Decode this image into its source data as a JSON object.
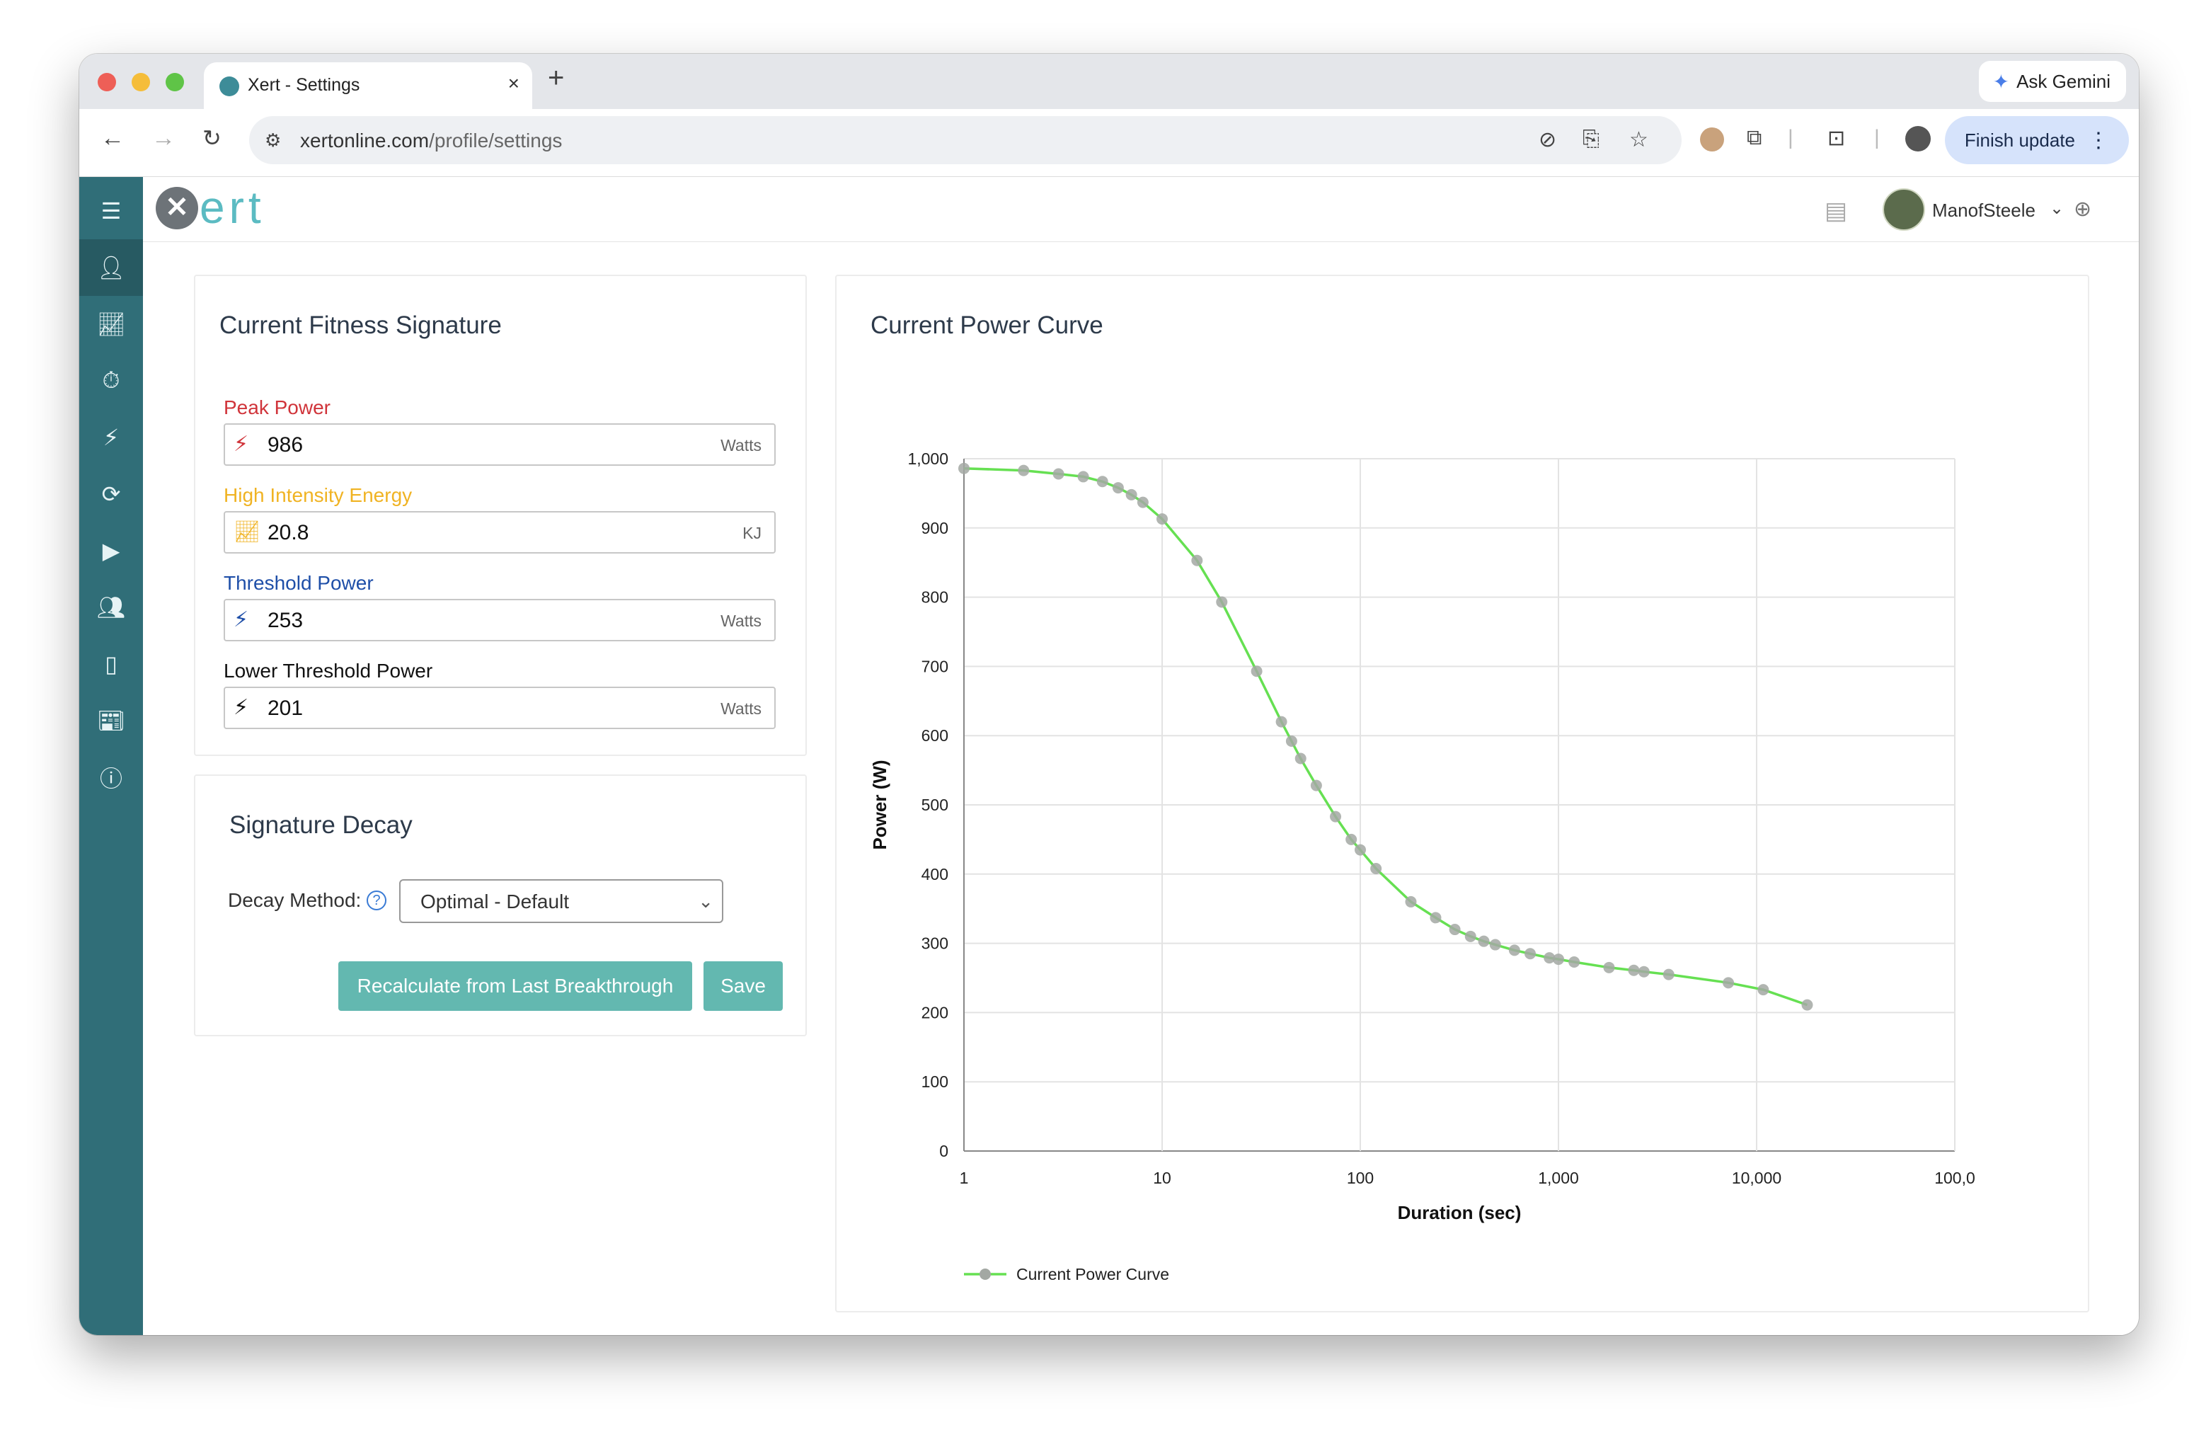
{
  "browser": {
    "tab_title": "Xert - Settings",
    "tab_close": "×",
    "new_tab": "+",
    "ask_gemini": "Ask Gemini",
    "url_domain": "xertonline.com",
    "url_path": "/profile/settings",
    "finish_update": "Finish update"
  },
  "header": {
    "logo_text": "ert",
    "username": "ManofSteele"
  },
  "fitness": {
    "title": "Current Fitness Signature",
    "fields": [
      {
        "label": "Peak Power",
        "value": "986",
        "unit": "Watts",
        "color": "#d0343a",
        "icon": "bolt-icon"
      },
      {
        "label": "High Intensity Energy",
        "value": "20.8",
        "unit": "KJ",
        "color": "#f0b323",
        "icon": "trend-icon"
      },
      {
        "label": "Threshold Power",
        "value": "253",
        "unit": "Watts",
        "color": "#1f4fa8",
        "icon": "bolt-icon"
      },
      {
        "label": "Lower Threshold Power",
        "value": "201",
        "unit": "Watts",
        "color": "#111111",
        "icon": "bolt-icon"
      }
    ]
  },
  "decay": {
    "title": "Signature Decay",
    "method_label": "Decay Method:",
    "method_value": "Optimal - Default",
    "recalc_button": "Recalculate from Last Breakthrough",
    "save_button": "Save"
  },
  "chart_data": {
    "type": "line",
    "title": "Current Power Curve",
    "xlabel": "Duration (sec)",
    "ylabel": "Power (W)",
    "xscale": "log",
    "xlim": [
      1,
      100000
    ],
    "ylim": [
      0,
      1000
    ],
    "xticks": [
      "1",
      "10",
      "100",
      "1,000",
      "10,000",
      "100,0"
    ],
    "yticks": [
      "0",
      "100",
      "200",
      "300",
      "400",
      "500",
      "600",
      "700",
      "800",
      "900",
      "1,000"
    ],
    "grid": true,
    "legend": "bottom-left",
    "color": "#66e052",
    "series": [
      {
        "name": "Current Power Curve",
        "points": [
          [
            1,
            986
          ],
          [
            2,
            983
          ],
          [
            3,
            978
          ],
          [
            4,
            974
          ],
          [
            5,
            967
          ],
          [
            6,
            958
          ],
          [
            7,
            948
          ],
          [
            8,
            937
          ],
          [
            10,
            913
          ],
          [
            15,
            853
          ],
          [
            20,
            793
          ],
          [
            30,
            693
          ],
          [
            40,
            620
          ],
          [
            45,
            592
          ],
          [
            50,
            567
          ],
          [
            60,
            528
          ],
          [
            75,
            483
          ],
          [
            90,
            450
          ],
          [
            100,
            435
          ],
          [
            120,
            408
          ],
          [
            180,
            360
          ],
          [
            240,
            337
          ],
          [
            300,
            320
          ],
          [
            360,
            310
          ],
          [
            420,
            303
          ],
          [
            480,
            298
          ],
          [
            600,
            290
          ],
          [
            720,
            285
          ],
          [
            900,
            279
          ],
          [
            1000,
            277
          ],
          [
            1200,
            273
          ],
          [
            1800,
            265
          ],
          [
            2400,
            261
          ],
          [
            2700,
            259
          ],
          [
            3600,
            255
          ],
          [
            7200,
            243
          ],
          [
            10800,
            233
          ],
          [
            18000,
            211
          ]
        ]
      }
    ]
  }
}
